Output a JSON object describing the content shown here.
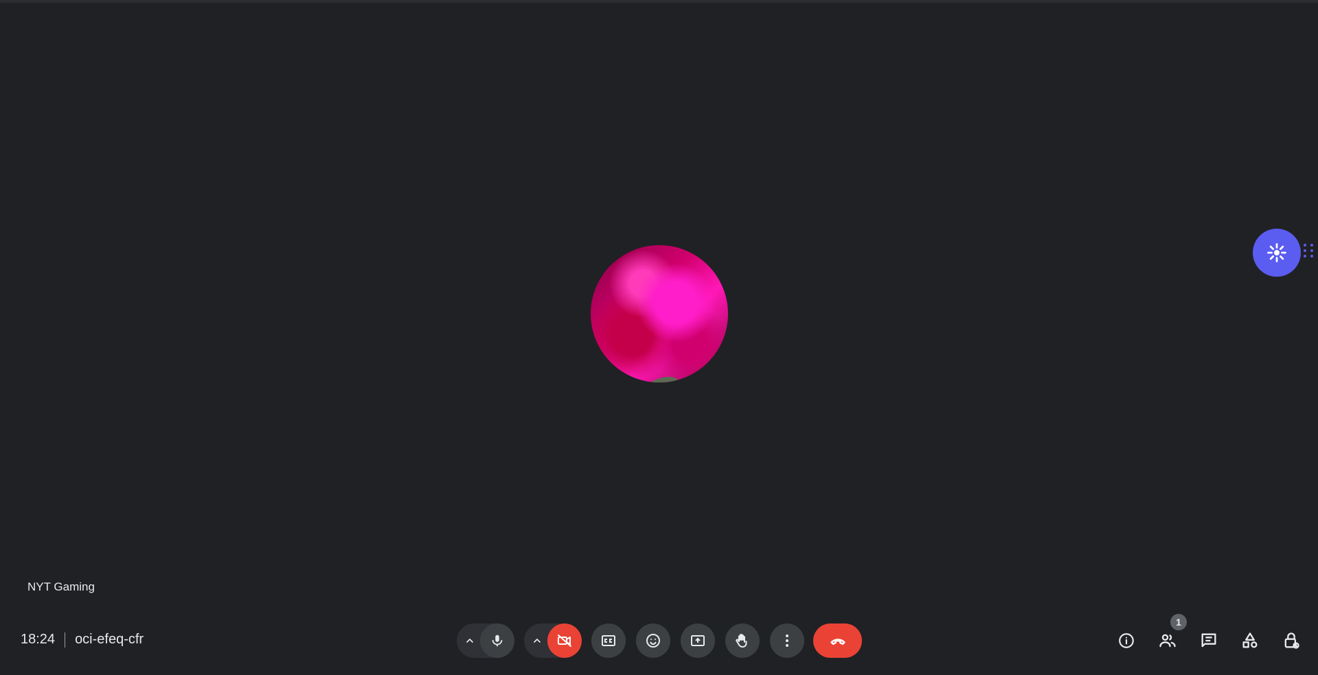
{
  "meeting": {
    "time": "18:24",
    "code": "oci-efeq-cfr"
  },
  "participant": {
    "name": "NYT Gaming"
  },
  "people": {
    "count": "1"
  },
  "colors": {
    "background": "#202124",
    "accent": "#5b5cf0",
    "danger": "#ea4335"
  },
  "icons": [
    "chevron-up-icon",
    "microphone-icon",
    "camera-off-icon",
    "captions-icon",
    "emoji-icon",
    "present-icon",
    "raise-hand-icon",
    "more-options-icon",
    "hang-up-icon",
    "info-icon",
    "people-icon",
    "chat-icon",
    "activities-icon",
    "host-controls-icon",
    "sparkle-icon"
  ]
}
